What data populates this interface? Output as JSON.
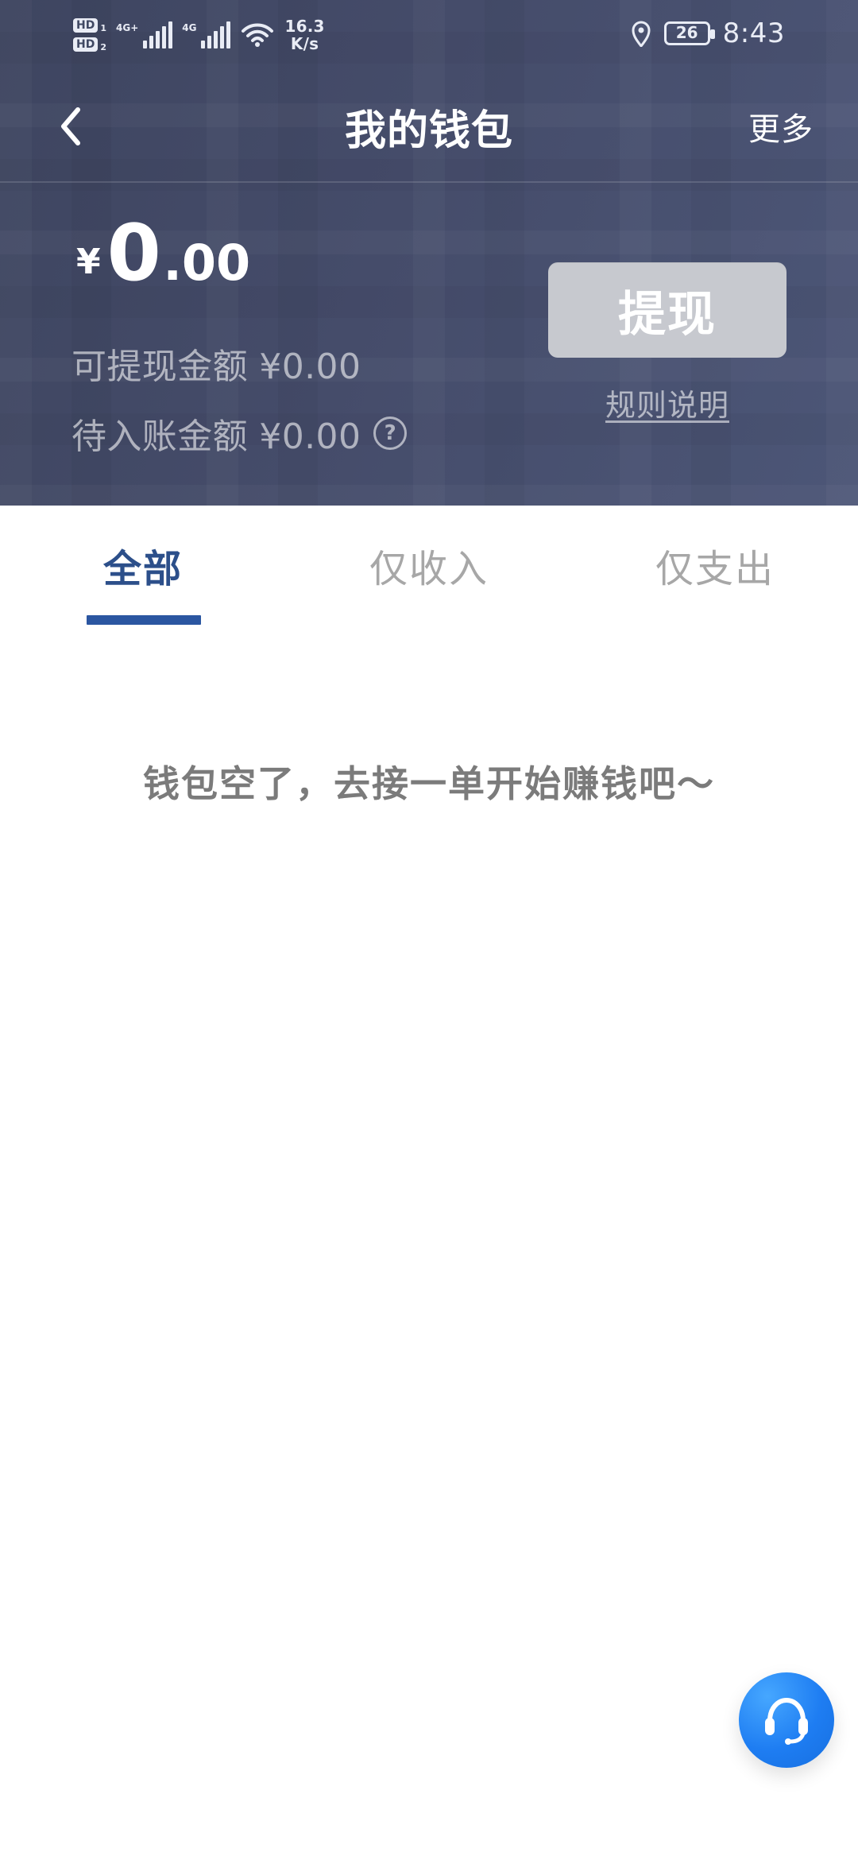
{
  "status_bar": {
    "hd1": "HD",
    "hd1_sub": "1",
    "hd2": "HD",
    "hd2_sub": "2",
    "net1": "4G+",
    "net2": "4G",
    "speed_value": "16.3",
    "speed_unit": "K/s",
    "battery": "26",
    "time": "8:43",
    "icons": [
      "hd-icon",
      "signal-icon",
      "wifi-icon",
      "location-icon",
      "battery-icon"
    ]
  },
  "topbar": {
    "title": "我的钱包",
    "more": "更多",
    "back_icon": "back-icon"
  },
  "wallet": {
    "currency": "¥",
    "balance_int": "0",
    "balance_dec": ".00",
    "available": "可提现金额 ¥0.00",
    "pending": "待入账金额 ¥0.00",
    "pending_help": "?",
    "withdraw": "提现",
    "rules": "规则说明"
  },
  "tabs": [
    {
      "label": "全部",
      "active": true
    },
    {
      "label": "仅收入",
      "active": false
    },
    {
      "label": "仅支出",
      "active": false
    }
  ],
  "empty_state": "钱包空了，去接一单开始赚钱吧～",
  "floating": {
    "icon": "customer-service-icon"
  },
  "colors": {
    "header_bg": "#454c6a",
    "tab_active": "#2c4f8a",
    "tab_indicator": "#2b56a1",
    "tab_inactive": "#a7a7a7",
    "withdraw_bg": "#c7c9cf",
    "fab_blue": "#1e7df2"
  }
}
